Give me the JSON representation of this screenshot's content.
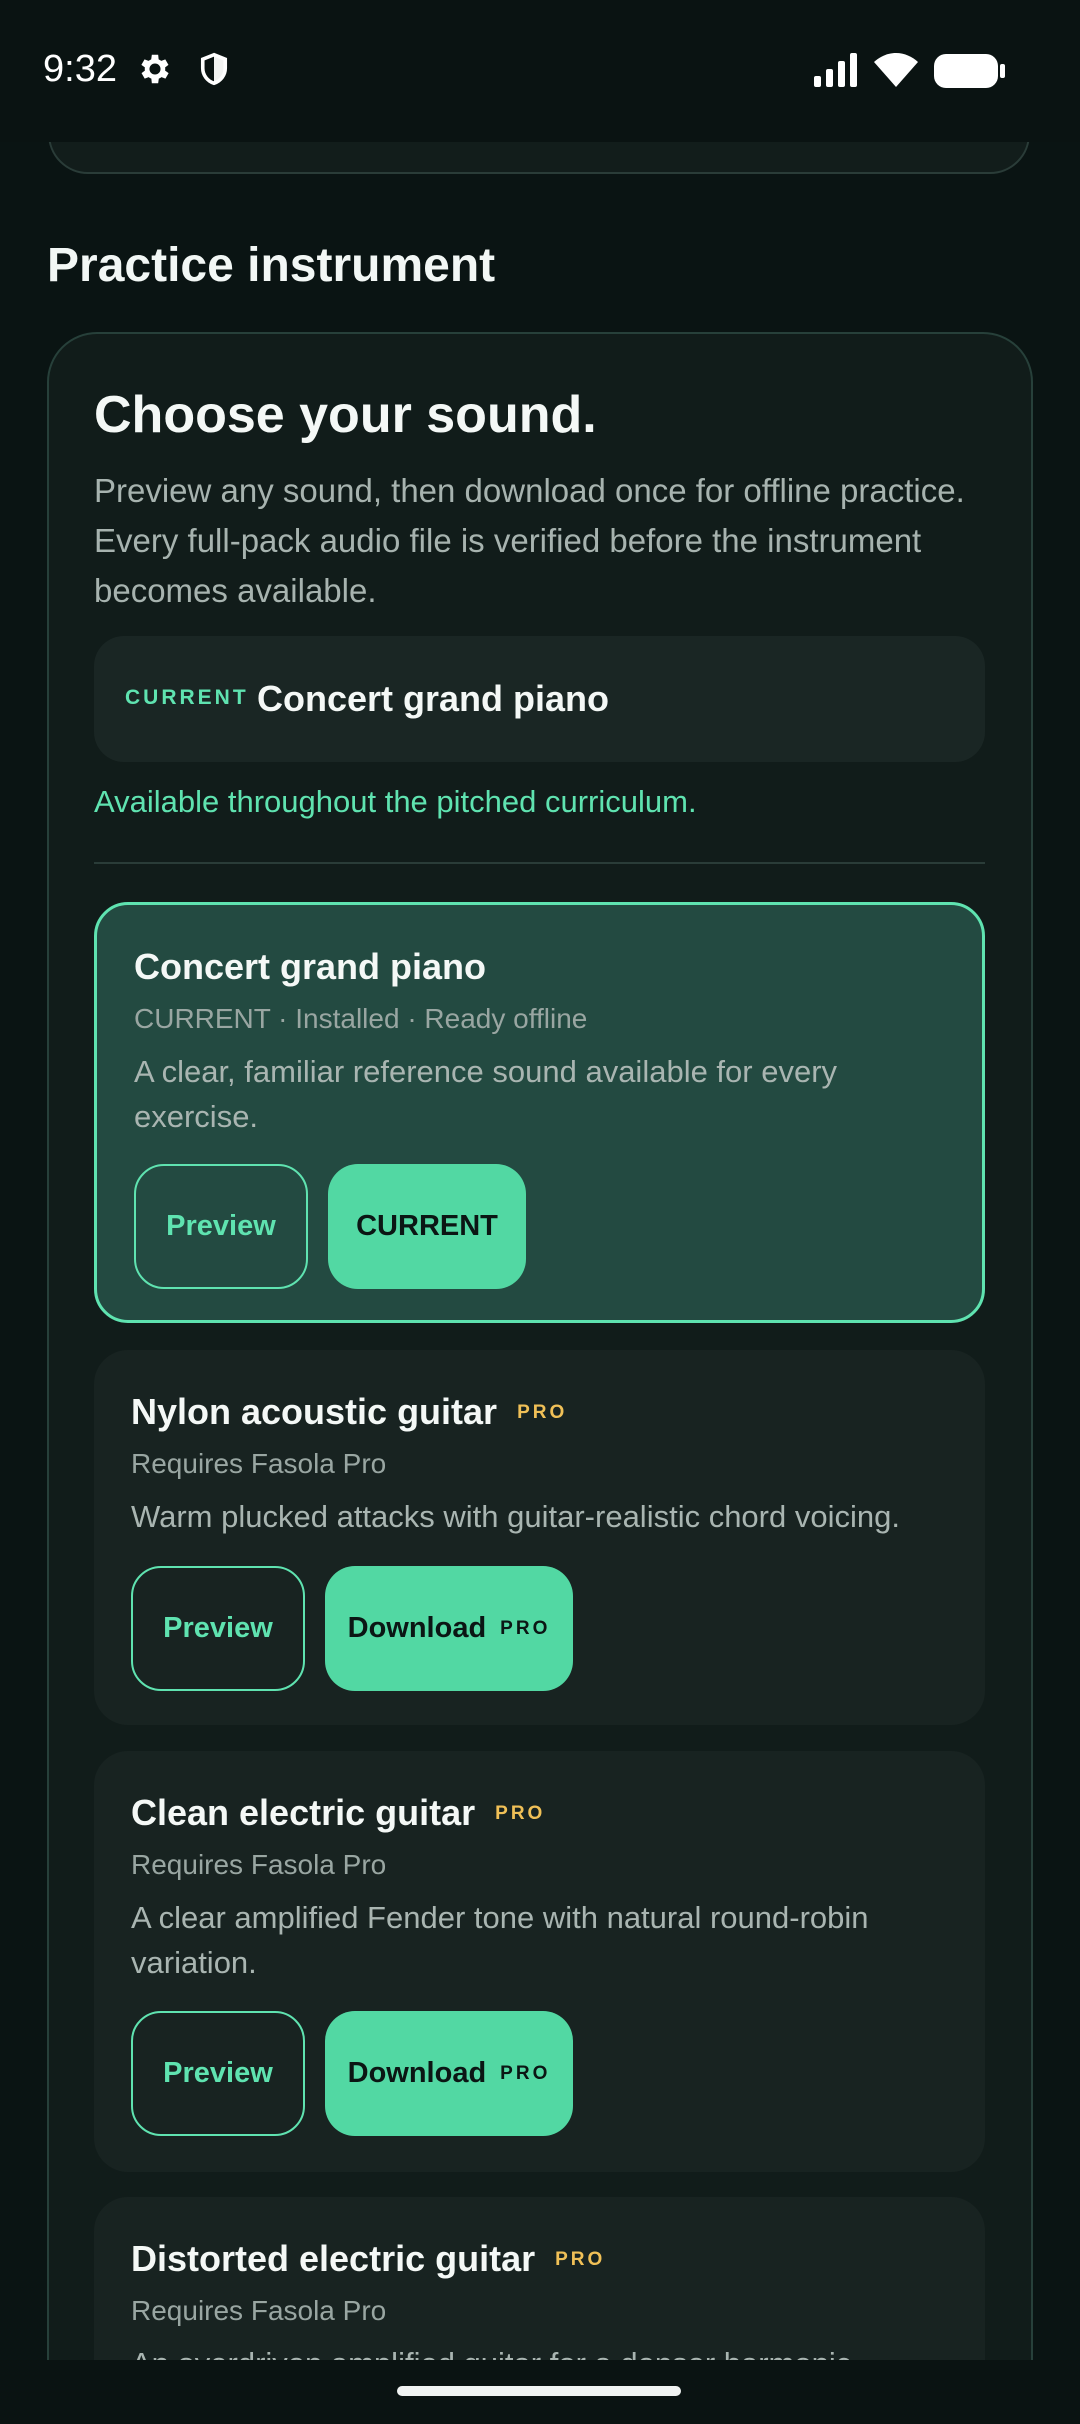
{
  "status_bar": {
    "time": "9:32",
    "icons": [
      "gear-icon",
      "shield-icon",
      "signal-icon",
      "wifi-icon",
      "battery-icon"
    ]
  },
  "section": {
    "title": "Practice instrument"
  },
  "chooser": {
    "title": "Choose your sound.",
    "description": "Preview any sound, then download once for offline practice. Every full-pack audio file is verified before the instrument becomes available.",
    "current_tag": "CURRENT",
    "current_name": "Concert grand piano",
    "availability": "Available throughout the pitched curriculum."
  },
  "instruments": [
    {
      "name": "Concert grand piano",
      "pro": "",
      "meta": "CURRENT · Installed · Ready offline",
      "description": "A clear, familiar reference sound available for every exercise.",
      "preview_label": "Preview",
      "action_label": "CURRENT",
      "action_pro": "",
      "selected": true
    },
    {
      "name": "Nylon acoustic guitar",
      "pro": "PRO",
      "meta": "Requires Fasola Pro",
      "description": "Warm plucked attacks with guitar-realistic chord voicing.",
      "preview_label": "Preview",
      "action_label": "Download",
      "action_pro": "PRO",
      "selected": false
    },
    {
      "name": "Clean electric guitar",
      "pro": "PRO",
      "meta": "Requires Fasola Pro",
      "description": "A clear amplified Fender tone with natural round-robin variation.",
      "preview_label": "Preview",
      "action_label": "Download",
      "action_pro": "PRO",
      "selected": false
    },
    {
      "name": "Distorted electric guitar",
      "pro": "PRO",
      "meta": "Requires Fasola Pro",
      "description": "An overdriven amplified guitar for a denser harmonic",
      "selected": false
    }
  ],
  "colors": {
    "background": "#0a1413",
    "accent": "#5fe3b0",
    "button": "#52d8a3",
    "pro": "#f0c057"
  }
}
